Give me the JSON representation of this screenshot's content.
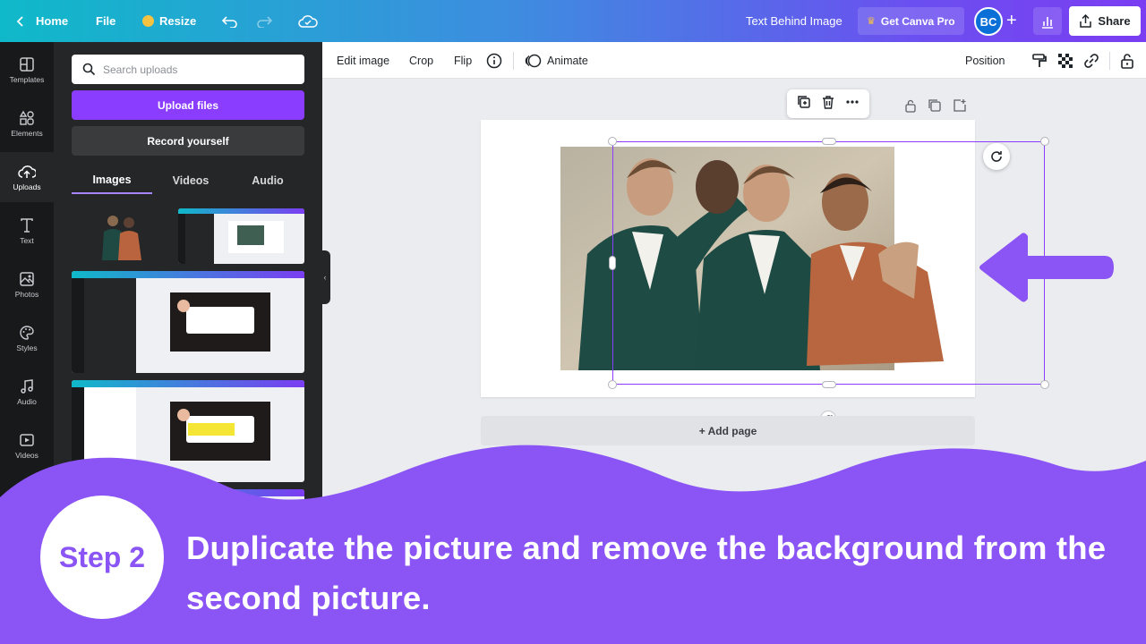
{
  "topbar": {
    "home": "Home",
    "file": "File",
    "resize": "Resize",
    "doc_title": "Text Behind Image",
    "get_pro": "Get Canva Pro",
    "avatar": "BC",
    "share": "Share"
  },
  "rail": {
    "items": [
      {
        "label": "Templates",
        "icon": "templates-icon"
      },
      {
        "label": "Elements",
        "icon": "elements-icon"
      },
      {
        "label": "Uploads",
        "icon": "upload-icon",
        "active": true
      },
      {
        "label": "Text",
        "icon": "text-icon"
      },
      {
        "label": "Photos",
        "icon": "photos-icon"
      },
      {
        "label": "Styles",
        "icon": "styles-icon"
      },
      {
        "label": "Audio",
        "icon": "audio-icon"
      },
      {
        "label": "Videos",
        "icon": "videos-icon"
      }
    ]
  },
  "panel": {
    "search_placeholder": "Search uploads",
    "upload_btn": "Upload files",
    "record_btn": "Record yourself",
    "tabs": [
      "Images",
      "Videos",
      "Audio"
    ]
  },
  "ctxbar": {
    "edit_image": "Edit image",
    "crop": "Crop",
    "flip": "Flip",
    "animate": "Animate",
    "position": "Position"
  },
  "canvas": {
    "add_page": "+ Add page"
  },
  "overlay": {
    "step": "Step 2",
    "text": "Duplicate the picture and remove the background from the second picture."
  },
  "colors": {
    "accent": "#8b3dff",
    "overlay": "#8b55f5"
  }
}
